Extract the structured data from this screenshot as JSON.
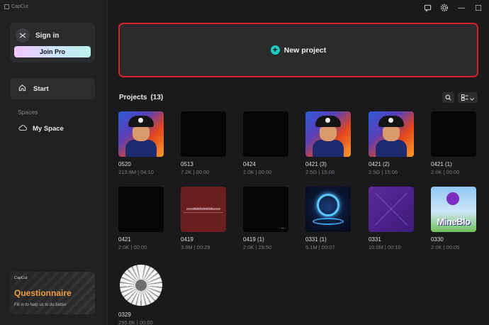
{
  "app": {
    "name": "CapCut"
  },
  "window_controls": {
    "feedback_icon": "chat-icon",
    "settings_icon": "gear-icon",
    "minimize_glyph": "—",
    "maximize_glyph": "☐"
  },
  "sidebar": {
    "sign_in_label": "Sign in",
    "join_pro_label": "Join Pro",
    "start_label": "Start",
    "spaces_heading": "Spaces",
    "my_space_label": "My Space",
    "promo": {
      "brand": "CapCut",
      "title": "Questionnaire",
      "subtitle": "Fill in to help us to do better"
    }
  },
  "main": {
    "new_project_label": "New project",
    "projects_label": "Projects",
    "projects_count": "(13)"
  },
  "projects": [
    {
      "name": "0520",
      "meta": "213.8M | 04:10",
      "thumb": "anime"
    },
    {
      "name": "0513",
      "meta": "7.2K | 00:00",
      "thumb": "black"
    },
    {
      "name": "0424",
      "meta": "2.0K | 00:00",
      "thumb": "black"
    },
    {
      "name": "0421 (3)",
      "meta": "2.5G | 15:06",
      "thumb": "anime"
    },
    {
      "name": "0421 (2)",
      "meta": "2.5G | 15:06",
      "thumb": "anime"
    },
    {
      "name": "0421 (1)",
      "meta": "2.0K | 00:00",
      "thumb": "black"
    },
    {
      "name": "0421",
      "meta": "2.0K | 00:00",
      "thumb": "black"
    },
    {
      "name": "0419",
      "meta": "3.9M | 00:29",
      "thumb": "red"
    },
    {
      "name": "0419 (1)",
      "meta": "2.0K | 29:50",
      "thumb": "black-dots"
    },
    {
      "name": "0331 (1)",
      "meta": "5.1M | 00:07",
      "thumb": "portal"
    },
    {
      "name": "0331",
      "meta": "10.0M | 00:10",
      "thumb": "purple"
    },
    {
      "name": "0330",
      "meta": "2.0K | 00:05",
      "thumb": "mine"
    },
    {
      "name": "0329",
      "meta": "295.6K | 00:00",
      "thumb": "flower"
    }
  ],
  "thumb_text": {
    "mine_word": "MineBlo",
    "red_caption": "MOTIVATE",
    "dots": "..."
  },
  "colors": {
    "accent": "#20c9c2",
    "highlight_border": "#d8202a",
    "background": "#1a1a1c"
  }
}
